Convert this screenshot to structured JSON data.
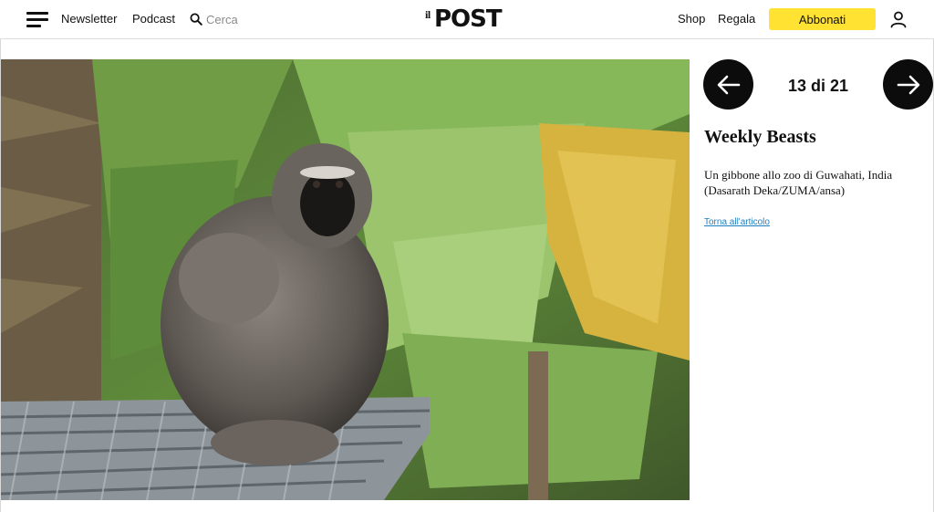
{
  "header": {
    "nav": {
      "newsletter": "Newsletter",
      "podcast": "Podcast",
      "search_placeholder": "Cerca"
    },
    "logo": {
      "il": "il",
      "post": "POST"
    },
    "right": {
      "shop": "Shop",
      "regala": "Regala",
      "subscribe": "Abbonati"
    }
  },
  "gallery": {
    "counter": "13 di 21",
    "title": "Weekly Beasts",
    "caption": "Un gibbone allo zoo di Guwahati, India (Dasarath Deka/ZUMA/ansa)",
    "back_link": "Torna all'articolo"
  },
  "colors": {
    "subscribe_bg": "#ffe232",
    "link": "#1e7fc0",
    "nav_circle": "#0c0c0c"
  },
  "icons": [
    "menu-icon",
    "search-icon",
    "user-icon",
    "arrow-left-icon",
    "arrow-right-icon"
  ]
}
